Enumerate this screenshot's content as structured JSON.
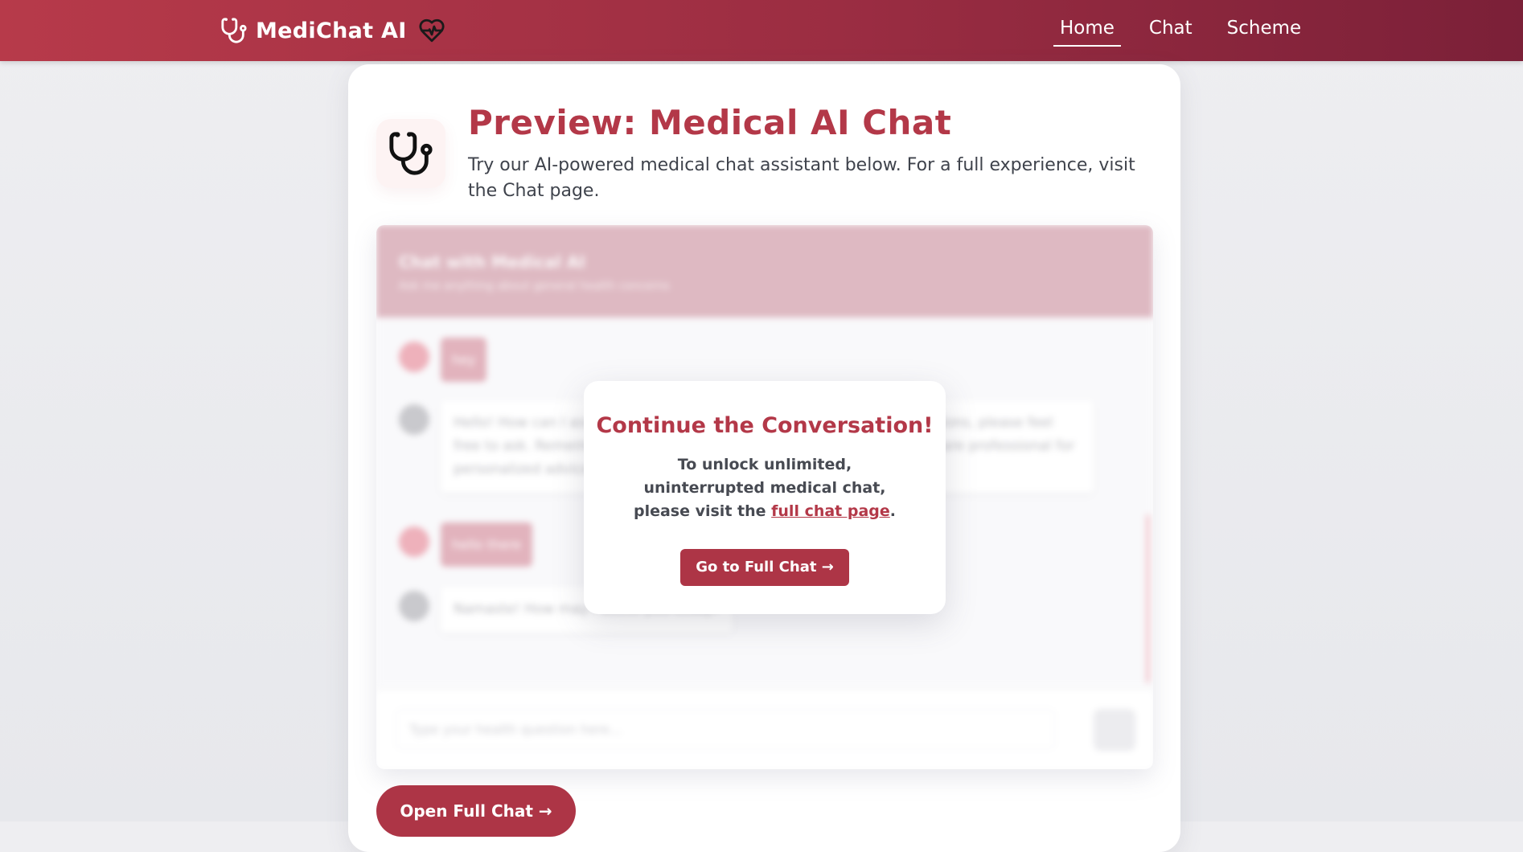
{
  "nav": {
    "brand": "MediChat AI",
    "items": [
      {
        "label": "Home",
        "active": true
      },
      {
        "label": "Chat",
        "active": false
      },
      {
        "label": "Scheme",
        "active": false
      }
    ]
  },
  "hero": {
    "title": "Preview: Medical AI Chat",
    "subtitle": "Try our AI-powered medical chat assistant below. For a full experience, visit the Chat page."
  },
  "preview_chat": {
    "header_title": "Chat with Medical AI",
    "header_subtitle": "Ask me anything about general health concerns",
    "messages": [
      {
        "role": "user",
        "text": "hey"
      },
      {
        "role": "bot",
        "text": "Hello! How can I assist you today? If you have any health-related questions, please feel free to ask. Remember, for any serious issues, please consult a healthcare professional for personalized advice."
      },
      {
        "role": "user",
        "text": "hello there"
      },
      {
        "role": "bot",
        "text": "Namaste! How may I assist you today?"
      }
    ],
    "input_placeholder": "Type your health question here..."
  },
  "modal": {
    "title": "Continue the Conversation!",
    "text_before": "To unlock unlimited, uninterrupted medical chat, please visit the ",
    "link_text": "full chat page",
    "text_after": ".",
    "button_label": "Go to Full Chat →"
  },
  "cta": {
    "label": "Open Full Chat →"
  },
  "colors": {
    "brand": "#b33848",
    "header_start": "#b73a4a",
    "header_end": "#7b2038"
  }
}
